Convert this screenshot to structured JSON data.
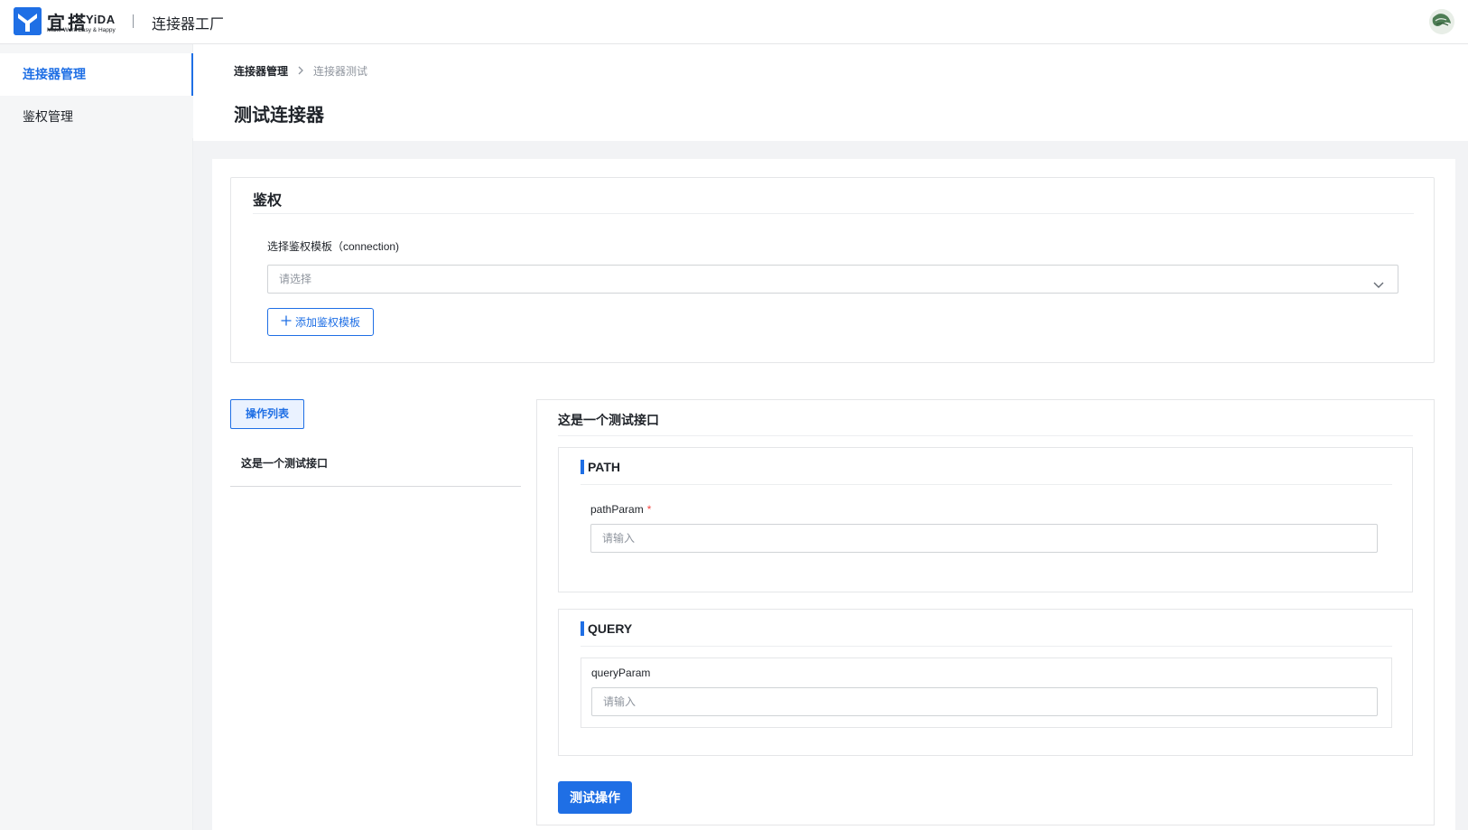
{
  "header": {
    "logo_cn": "宜搭",
    "logo_en": "YiDA",
    "logo_slogan": "Make Work Easy & Happy",
    "app_title": "连接器工厂"
  },
  "sidebar": {
    "items": [
      {
        "label": "连接器管理",
        "active": true
      },
      {
        "label": "鉴权管理",
        "active": false
      }
    ]
  },
  "breadcrumb": {
    "items": [
      "连接器管理",
      "连接器测试"
    ]
  },
  "page": {
    "title": "测试连接器"
  },
  "auth": {
    "title": "鉴权",
    "select_label": "选择鉴权模板（connection)",
    "select_placeholder": "请选择",
    "add_button": "添加鉴权模板"
  },
  "operations": {
    "tab_label": "操作列表",
    "items": [
      "这是一个测试接口"
    ]
  },
  "detail": {
    "title": "这是一个测试接口",
    "path": {
      "label": "PATH",
      "param_name": "pathParam",
      "required_mark": "*",
      "placeholder": "请输入"
    },
    "query": {
      "label": "QUERY",
      "param_name": "queryParam",
      "placeholder": "请输入"
    },
    "test_button": "测试操作"
  },
  "colors": {
    "accent": "#1f6fe5",
    "sidebar_bg": "#f5f6f7",
    "canvas_bg": "#f2f3f5",
    "required": "#f54a45"
  }
}
